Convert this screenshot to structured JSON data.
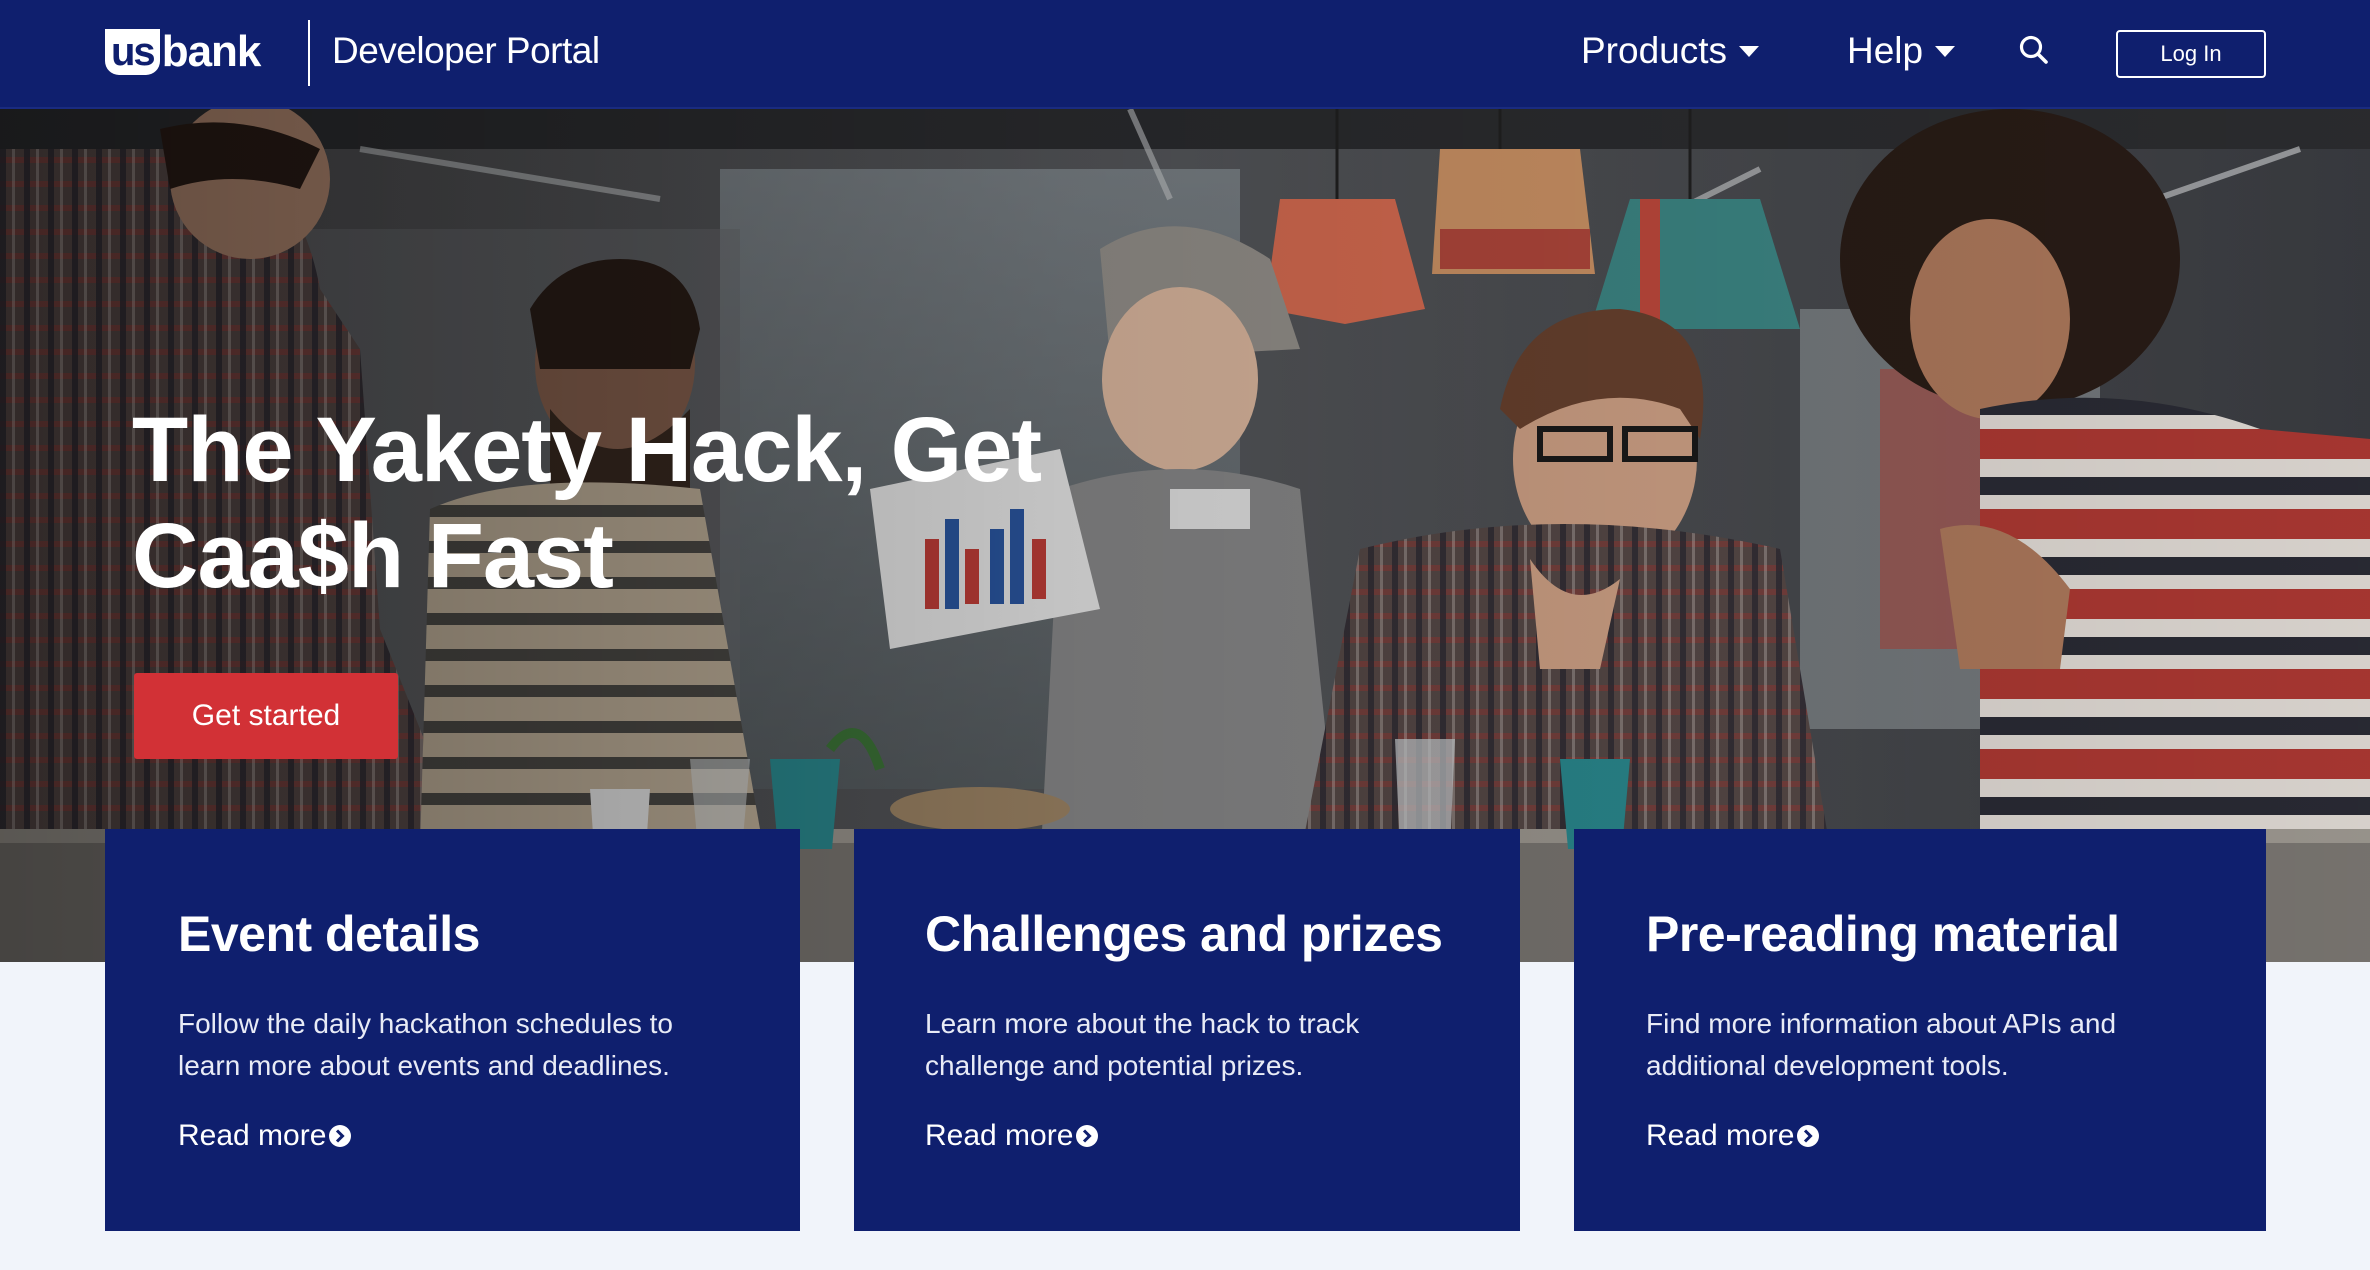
{
  "header": {
    "logo_us": "us",
    "logo_bank": "bank",
    "portal_name": "Developer Portal",
    "nav": {
      "products_label": "Products",
      "help_label": "Help"
    },
    "search_icon": "search-icon",
    "login_label": "Log In"
  },
  "hero": {
    "title": "The Yakety Hack, Get Caa$h Fast",
    "cta_label": "Get started"
  },
  "cards": [
    {
      "title": "Event details",
      "text": "Follow the daily hackathon schedules to learn more about events and deadlines.",
      "link": "Read more"
    },
    {
      "title": "Challenges and prizes",
      "text": "Learn more about the hack to track challenge and potential prizes.",
      "link": "Read more"
    },
    {
      "title": "Pre-reading material",
      "text": "Find more information about APIs and additional development tools.",
      "link": "Read more"
    }
  ],
  "colors": {
    "brand_navy": "#0f1f6e",
    "cta_red": "#d23136",
    "page_bg": "#f1f4fa"
  }
}
